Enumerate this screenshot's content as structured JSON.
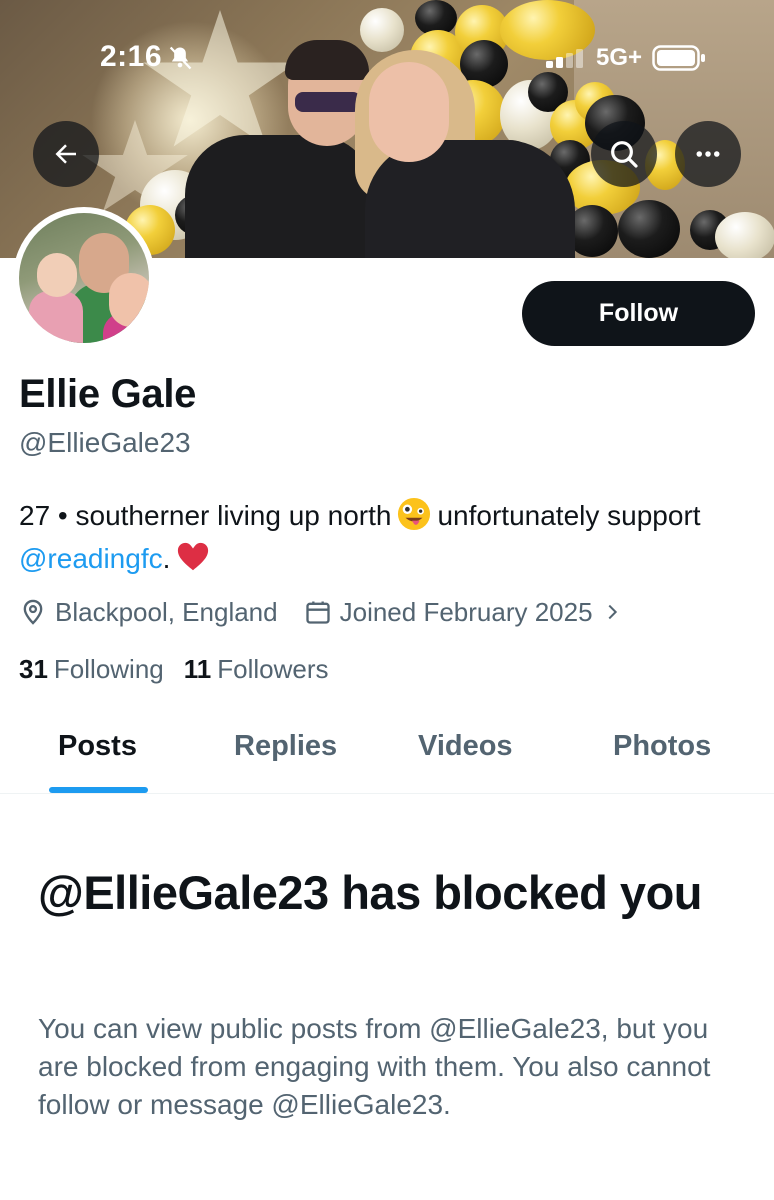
{
  "status_bar": {
    "time": "2:16",
    "network": "5G+",
    "icons": [
      "bell-slash-icon",
      "signal-icon",
      "battery-icon"
    ]
  },
  "header": {
    "back_icon": "arrow-left-icon",
    "search_icon": "search-icon",
    "more_icon": "more-horizontal-icon"
  },
  "profile": {
    "display_name": "Ellie Gale",
    "handle": "@EllieGale23",
    "follow_label": "Follow",
    "bio": {
      "part1": "27 • southerner living up north",
      "emoji1": "zany-face-emoji",
      "part2": "unfortunately support",
      "mention": "@readingfc",
      "part3": ".",
      "emoji2": "red-heart-emoji"
    },
    "location": "Blackpool, England",
    "joined": "Joined February 2025",
    "following_count": "31",
    "following_label": "Following",
    "followers_count": "11",
    "followers_label": "Followers"
  },
  "tabs": [
    {
      "label": "Posts",
      "active": true
    },
    {
      "label": "Replies",
      "active": false
    },
    {
      "label": "Videos",
      "active": false
    },
    {
      "label": "Photos",
      "active": false
    }
  ],
  "blocked": {
    "title": "@EllieGale23 has blocked you",
    "description": "You can view public posts from @EllieGale23, but you are blocked from engaging with them. You also cannot follow or message @EllieGale23."
  },
  "colors": {
    "accent": "#1d9bf0",
    "text_primary": "#0f1419",
    "text_secondary": "#536471",
    "button_dark": "#0f1419"
  }
}
